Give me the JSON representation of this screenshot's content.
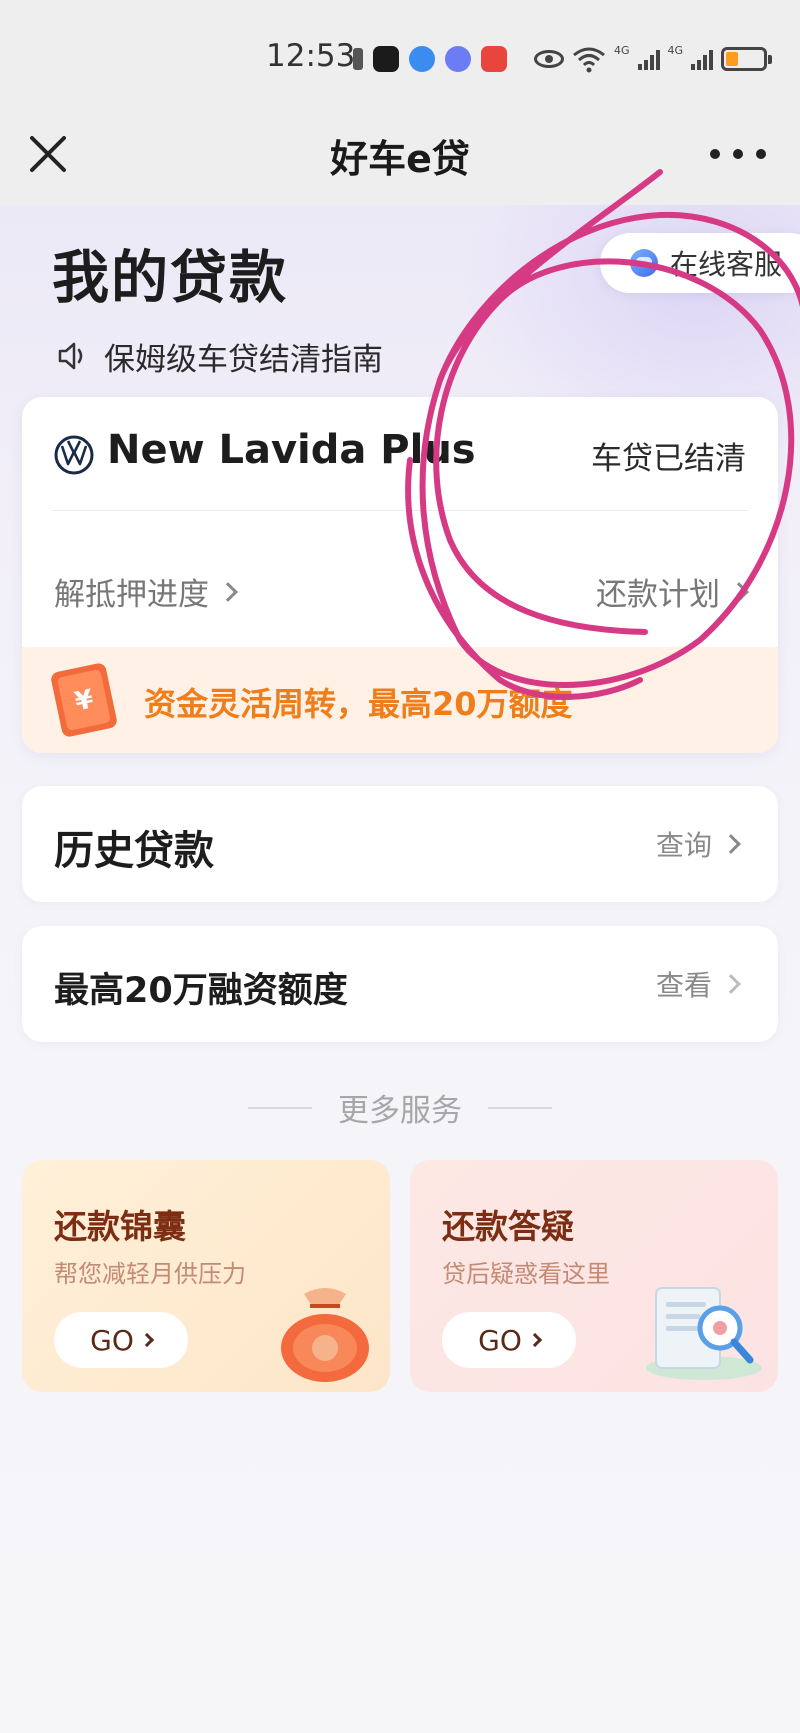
{
  "status_bar": {
    "time": "12:53",
    "network_1": "4G",
    "network_2": "4G",
    "battery_level": 0.3
  },
  "nav": {
    "title": "好车e贷"
  },
  "header": {
    "title": "我的贷款",
    "service_button": "在线客服",
    "guide_text": "保姆级车贷结清指南"
  },
  "loan_card": {
    "car_name": "New Lavida Plus",
    "status": "车贷已结清",
    "link_left": "解抵押进度",
    "link_right": "还款计划",
    "promo_text": "资金灵活周转，最高20万额度",
    "coupon_symbol": "¥"
  },
  "rows": [
    {
      "title": "历史贷款",
      "action": "查询"
    },
    {
      "title": "最高20万融资额度",
      "action": "查看"
    }
  ],
  "more_services": {
    "heading": "更多服务",
    "cards": [
      {
        "title": "还款锦囊",
        "subtitle": "帮您减轻月供压力",
        "button": "GO"
      },
      {
        "title": "还款答疑",
        "subtitle": "贷后疑惑看这里",
        "button": "GO"
      }
    ]
  },
  "colors": {
    "promo_text": "#ee7d1a",
    "scribble": "#d63a85",
    "service_title": "#7c2d12"
  },
  "icons": {
    "close": "close-icon",
    "more": "more-icon",
    "speaker": "speaker-icon",
    "brand": "vw-logo-icon",
    "service": "customer-service-icon"
  }
}
